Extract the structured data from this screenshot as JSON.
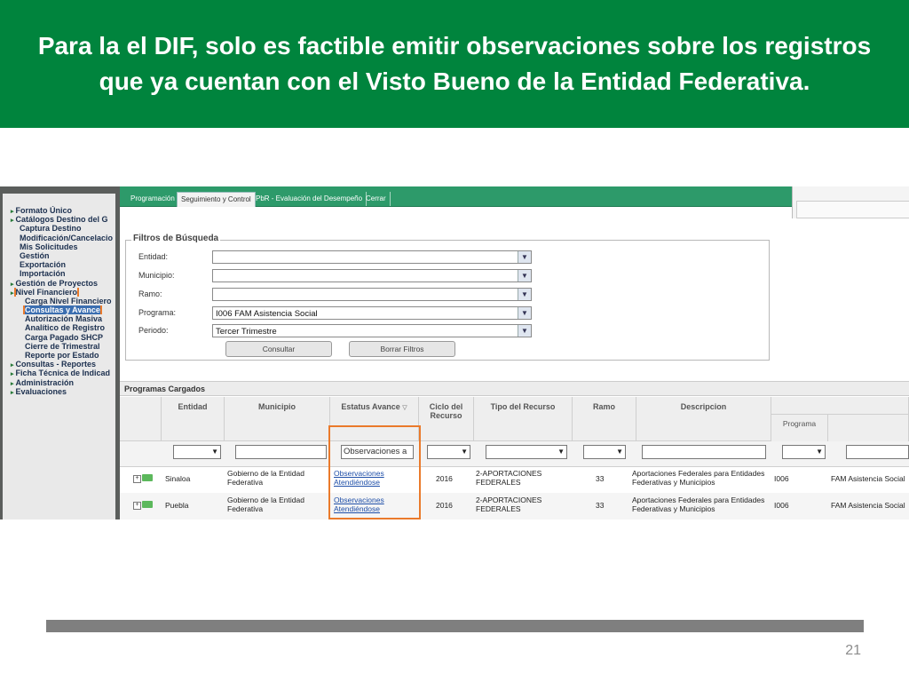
{
  "slide": {
    "title": "Para la el DIF, solo es factible emitir observaciones sobre los registros que ya cuentan con el Visto Bueno de la Entidad Federativa.",
    "page_number": "21"
  },
  "nav": {
    "items": [
      {
        "label": "Formato Único",
        "level": 0
      },
      {
        "label": "Catálogos Destino del G",
        "level": 0
      },
      {
        "label": "Captura Destino",
        "level": 1
      },
      {
        "label": "Modificación/Cancelacio",
        "level": 1
      },
      {
        "label": "Mis Solicitudes",
        "level": 1
      },
      {
        "label": "Gestión",
        "level": 1
      },
      {
        "label": "Exportación",
        "level": 1
      },
      {
        "label": "Importación",
        "level": 1
      },
      {
        "label": "Gestión de Proyectos",
        "level": 0
      },
      {
        "label": "Nivel Financiero",
        "level": 0
      },
      {
        "label": "Carga Nivel Financiero",
        "level": 2
      },
      {
        "label": "Consultas y Avance",
        "level": 2
      },
      {
        "label": "Autorización Masiva",
        "level": 2
      },
      {
        "label": "Analítico de Registro",
        "level": 2
      },
      {
        "label": "Carga Pagado SHCP",
        "level": 2
      },
      {
        "label": "Cierre de Trimestral",
        "level": 2
      },
      {
        "label": "Reporte por Estado",
        "level": 2
      },
      {
        "label": "Consultas - Reportes",
        "level": 0
      },
      {
        "label": "Ficha Técnica de Indicad",
        "level": 0
      },
      {
        "label": "Administración",
        "level": 0
      },
      {
        "label": "Evaluaciones",
        "level": 0
      }
    ]
  },
  "tabs": [
    "Programación",
    "Seguimiento y Control",
    "PbR - Evaluación del Desempeño",
    "Cerrar"
  ],
  "filters": {
    "title": "Filtros de Búsqueda",
    "fields": [
      {
        "label": "Entidad:",
        "value": ""
      },
      {
        "label": "Municipio:",
        "value": ""
      },
      {
        "label": "Ramo:",
        "value": ""
      },
      {
        "label": "Programa:",
        "value": "I006 FAM Asistencia Social"
      },
      {
        "label": "Periodo:",
        "value": "Tercer Trimestre"
      }
    ],
    "consultar_label": "Consultar",
    "borrar_label": "Borrar Filtros"
  },
  "grid": {
    "title": "Programas Cargados",
    "columns": [
      "Entidad",
      "Municipio",
      "Estatus Avance",
      "Ciclo del Recurso",
      "Tipo del Recurso",
      "Ramo",
      "Descripcion",
      "Programa"
    ],
    "status_filter_value": "Observaciones a",
    "rows": [
      {
        "entidad": "Sinaloa",
        "municipio": "Gobierno de la Entidad Federativa",
        "estatus": "Observaciones Atendiéndose",
        "ciclo": "2016",
        "tipo": "2-APORTACIONES FEDERALES",
        "ramo": "33",
        "descripcion": "Aportaciones Federales para Entidades Federativas y Municipios",
        "programa": "I006",
        "programa_nombre": "FAM Asistencia Social"
      },
      {
        "entidad": "Puebla",
        "municipio": "Gobierno de la Entidad Federativa",
        "estatus": "Observaciones Atendiéndose",
        "ciclo": "2016",
        "tipo": "2-APORTACIONES FEDERALES",
        "ramo": "33",
        "descripcion": "Aportaciones Federales para Entidades Federativas y Municipios",
        "programa": "I006",
        "programa_nombre": "FAM Asistencia Social"
      }
    ]
  },
  "colors": {
    "banner": "#00843d",
    "highlight": "#ea7a2b"
  }
}
